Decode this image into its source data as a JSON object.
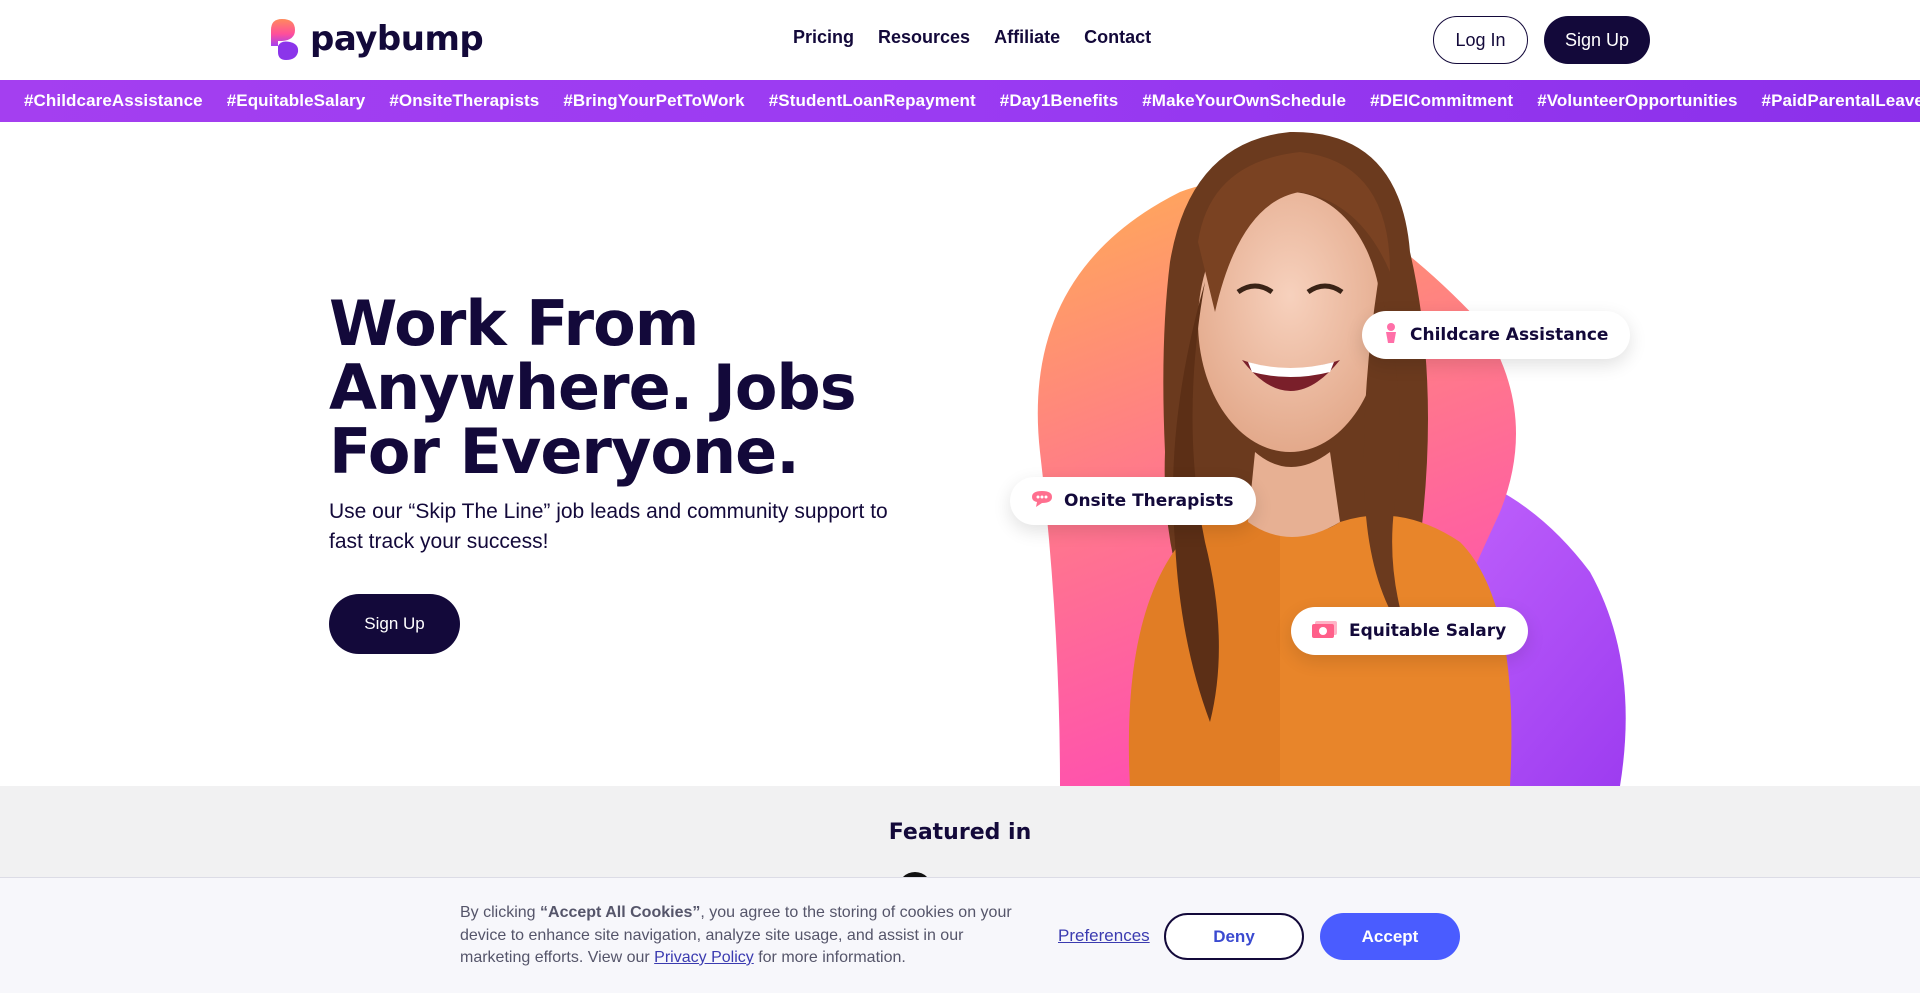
{
  "header": {
    "logo_text": "paybump",
    "nav": [
      {
        "label": "Pricing"
      },
      {
        "label": "Resources"
      },
      {
        "label": "Affiliate"
      },
      {
        "label": "Contact"
      }
    ],
    "login_label": "Log In",
    "signup_label": "Sign Up"
  },
  "ticker": {
    "items": [
      "#ChildcareAssistance",
      "#EquitableSalary",
      "#OnsiteTherapists",
      "#BringYourPetToWork",
      "#StudentLoanRepayment",
      "#Day1Benefits",
      "#MakeYourOwnSchedule",
      "#DEICommitment",
      "#VolunteerOpportunities",
      "#PaidParentalLeave"
    ]
  },
  "hero": {
    "title": "Work From Anywhere. Jobs For Everyone.",
    "subtitle": "Use our “Skip The Line” job leads and community support to fast track your success!",
    "cta_label": "Sign Up",
    "pills": {
      "childcare": "Childcare Assistance",
      "therapists": "Onsite Therapists",
      "salary": "Equitable Salary"
    }
  },
  "featured": {
    "title": "Featured in"
  },
  "cookie": {
    "text_prefix": "By clicking ",
    "text_bold": "“Accept All Cookies”",
    "text_middle": ", you agree to the storing of cookies on your device to enhance site navigation, analyze site usage, and assist in our marketing efforts. View our ",
    "privacy_label": "Privacy Policy",
    "text_suffix": " for more information.",
    "preferences_label": "Preferences",
    "deny_label": "Deny",
    "accept_label": "Accept"
  },
  "colors": {
    "brand_dark": "#13093a",
    "ticker_purple": "#9a3bf2",
    "accent_blue": "#4a5cff",
    "blob_orange": "#ffa85a",
    "blob_pink": "#ff5fa8",
    "blob_purple": "#a84ef0"
  }
}
